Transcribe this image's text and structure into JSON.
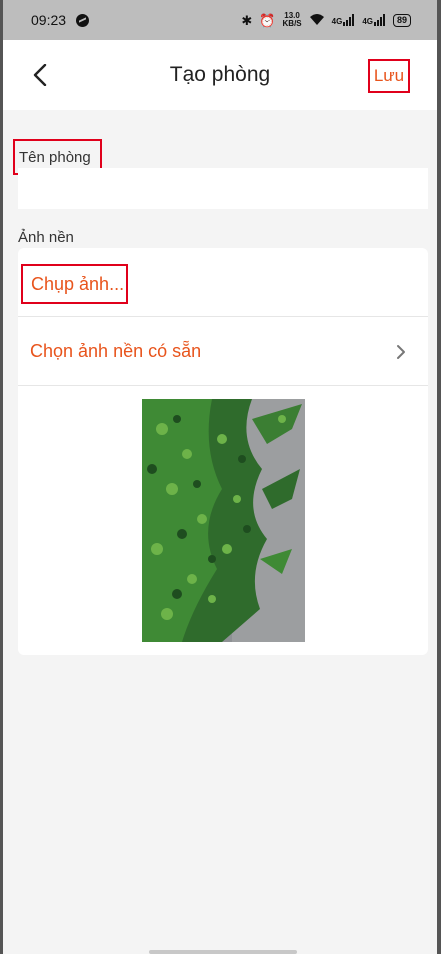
{
  "status_bar": {
    "time": "09:23",
    "net_speed_value": "13.0",
    "net_speed_unit": "KB/S",
    "signal_1": "4G",
    "signal_2": "4G",
    "battery": "89"
  },
  "header": {
    "title": "Tạo phòng",
    "save_label": "Lưu"
  },
  "form": {
    "room_name_label": "Tên phòng",
    "room_name_value": "",
    "background_label": "Ảnh nền",
    "take_photo_label": "Chụp ảnh...",
    "choose_background_label": "Chọn ảnh nền có sẵn"
  },
  "colors": {
    "accent": "#e8541c",
    "highlight_border": "#e0001b",
    "status_bar_bg": "#bdbdbd",
    "page_bg": "#f4f4f4"
  }
}
